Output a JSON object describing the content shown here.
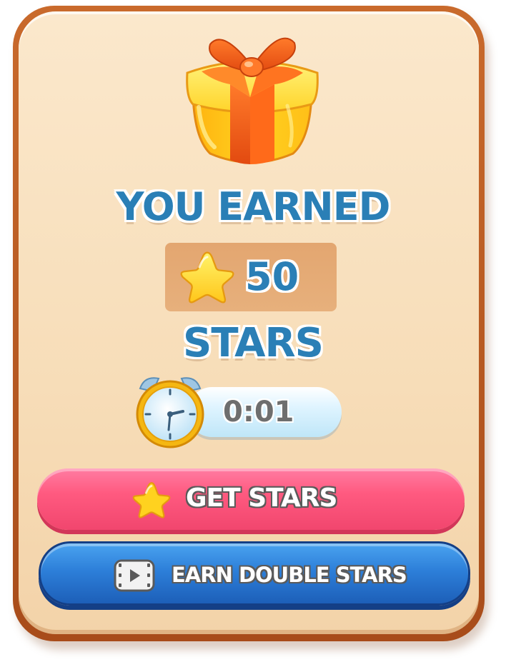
{
  "reward": {
    "heading_top": "YOU EARNED",
    "amount": "50",
    "heading_bottom": "STARS"
  },
  "timer": {
    "value": "0:01"
  },
  "buttons": {
    "get_stars_label": "GET STARS",
    "earn_double_label": "EARN DOUBLE STARS"
  },
  "icons": {
    "gift": "gift-box-icon",
    "star": "star-icon",
    "clock": "alarm-clock-icon",
    "video": "video-play-icon"
  },
  "colors": {
    "heading_blue": "#2a7fb6",
    "panel_border": "#b85a22",
    "panel_fill": "#f7ddb8",
    "get_button": "#ff5a80",
    "earn_button": "#2d7fd9",
    "star_gold": "#ffd21f"
  }
}
